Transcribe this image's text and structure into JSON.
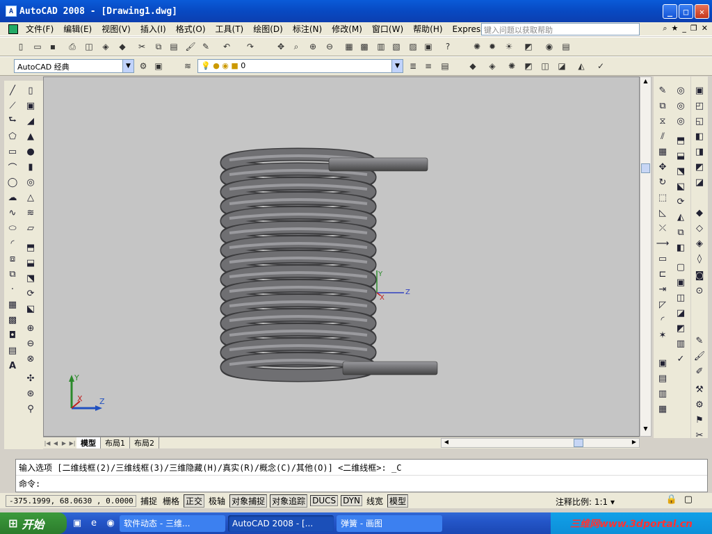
{
  "window": {
    "title": "AutoCAD 2008 - [Drawing1.dwg]"
  },
  "menu": {
    "items": [
      "文件(F)",
      "编辑(E)",
      "视图(V)",
      "插入(I)",
      "格式(O)",
      "工具(T)",
      "绘图(D)",
      "标注(N)",
      "修改(M)",
      "窗口(W)",
      "帮助(H)",
      "Express"
    ],
    "help_placeholder": "键入问题以获取帮助"
  },
  "toolbar": {
    "workspace_value": "AutoCAD 经典",
    "layer_value": "0"
  },
  "viewport": {
    "ucs_labels": {
      "y": "Y",
      "x": "X",
      "z": "Z"
    },
    "object": "helical spring (3D realistic visual style)"
  },
  "layout_tabs": [
    "模型",
    "布局1",
    "布局2"
  ],
  "command": {
    "line1": "输入选项 [二维线框(2)/三维线框(3)/三维隐藏(H)/真实(R)/概念(C)/其他(O)] <二维线框>: _C",
    "line2": "命令:"
  },
  "status": {
    "coords": "-375.1999, 68.0630 , 0.0000",
    "toggles": [
      "捕捉",
      "栅格",
      "正交",
      "极轴",
      "对象捕捉",
      "对象追踪",
      "DUCS",
      "DYN",
      "线宽",
      "模型"
    ],
    "annotation_scale": "注释比例: 1:1"
  },
  "taskbar": {
    "start": "开始",
    "tasks": [
      "软件动态 - 三维...",
      "AutoCAD 2008 - [...",
      "弹簧 - 画图"
    ],
    "watermark": "三维网www.3dportal.cn"
  },
  "colors": {
    "spring": "#6f6f72",
    "spring_highlight": "#9a9a9e",
    "viewport_bg": "#c5c5c5"
  }
}
